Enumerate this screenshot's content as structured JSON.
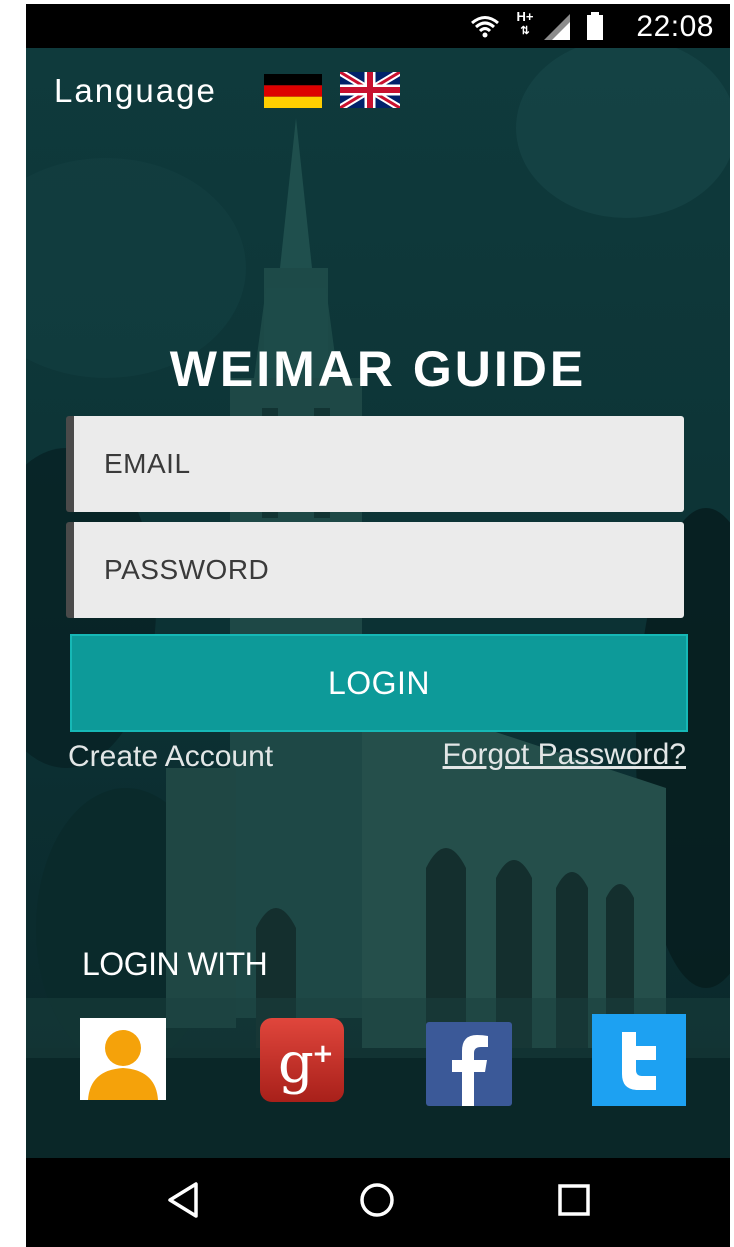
{
  "status_bar": {
    "time": "22:08",
    "network_type": "H+",
    "icons": [
      "wifi-icon",
      "network-type-icon",
      "cell-signal-icon",
      "battery-icon"
    ]
  },
  "language": {
    "label": "Language",
    "options": [
      {
        "name": "german-flag-icon"
      },
      {
        "name": "uk-flag-icon"
      }
    ]
  },
  "app": {
    "title": "WEIMAR GUIDE"
  },
  "form": {
    "email_placeholder": "EMAIL",
    "email_value": "",
    "password_placeholder": "PASSWORD",
    "password_value": "",
    "login_label": "LOGIN",
    "create_account_label": "Create Account",
    "forgot_password_label": "Forgot Password?"
  },
  "social": {
    "heading": "LOGIN WITH",
    "buttons": [
      {
        "name": "guest-login-button",
        "icon": "user-avatar-icon",
        "color": "#f5a20a"
      },
      {
        "name": "google-plus-login-button",
        "icon": "google-plus-icon",
        "color": "#c5281f"
      },
      {
        "name": "facebook-login-button",
        "icon": "facebook-icon",
        "color": "#3b5998"
      },
      {
        "name": "twitter-login-button",
        "icon": "twitter-icon",
        "color": "#1da1f2"
      }
    ]
  },
  "nav_bar": {
    "buttons": [
      "back-icon",
      "home-icon",
      "recents-icon"
    ]
  },
  "colors": {
    "accent": "#0d9a99",
    "background": "#0d3537"
  }
}
